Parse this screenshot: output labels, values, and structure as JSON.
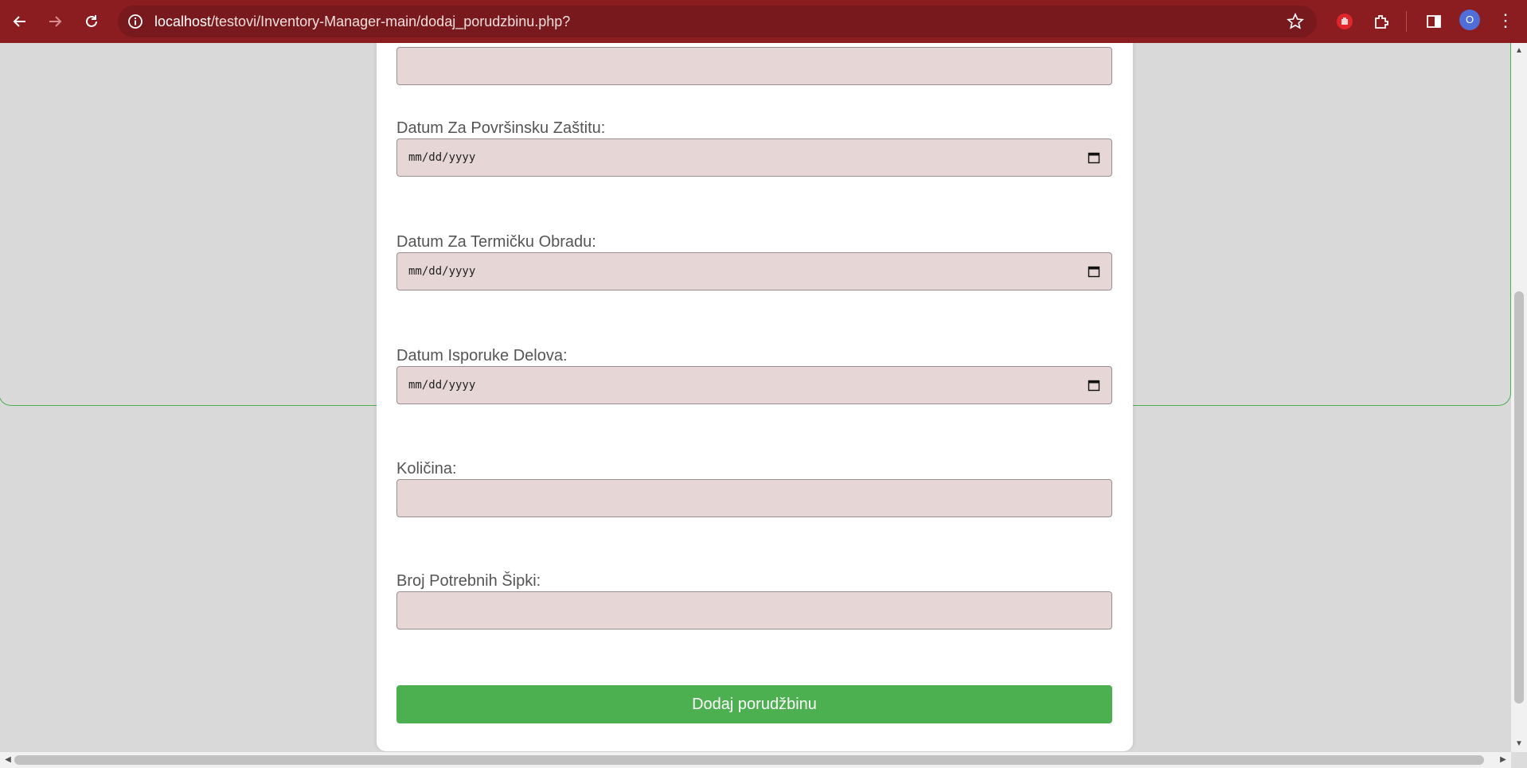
{
  "browser": {
    "url_host": "localhost",
    "url_path": "/testovi/Inventory-Manager-main/dodaj_porudzbinu.php?",
    "profile_initial": "O",
    "theme_color": "#8b1c20"
  },
  "form": {
    "fields": [
      {
        "label": "",
        "type": "text",
        "value": ""
      },
      {
        "label": "Datum Za Površinsku Zaštitu:",
        "type": "date",
        "placeholder": "mm/dd/yyyy"
      },
      {
        "label": "Datum Za Termičku Obradu:",
        "type": "date",
        "placeholder": "mm/dd/yyyy"
      },
      {
        "label": "Datum Isporuke Delova:",
        "type": "date",
        "placeholder": "mm/dd/yyyy"
      },
      {
        "label": "Količina:",
        "type": "text",
        "value": ""
      },
      {
        "label": "Broj Potrebnih Šipki:",
        "type": "text",
        "value": ""
      }
    ],
    "submit_label": "Dodaj porudžbinu",
    "accent_color": "#4caf50",
    "input_bg": "#e7d6d6"
  }
}
